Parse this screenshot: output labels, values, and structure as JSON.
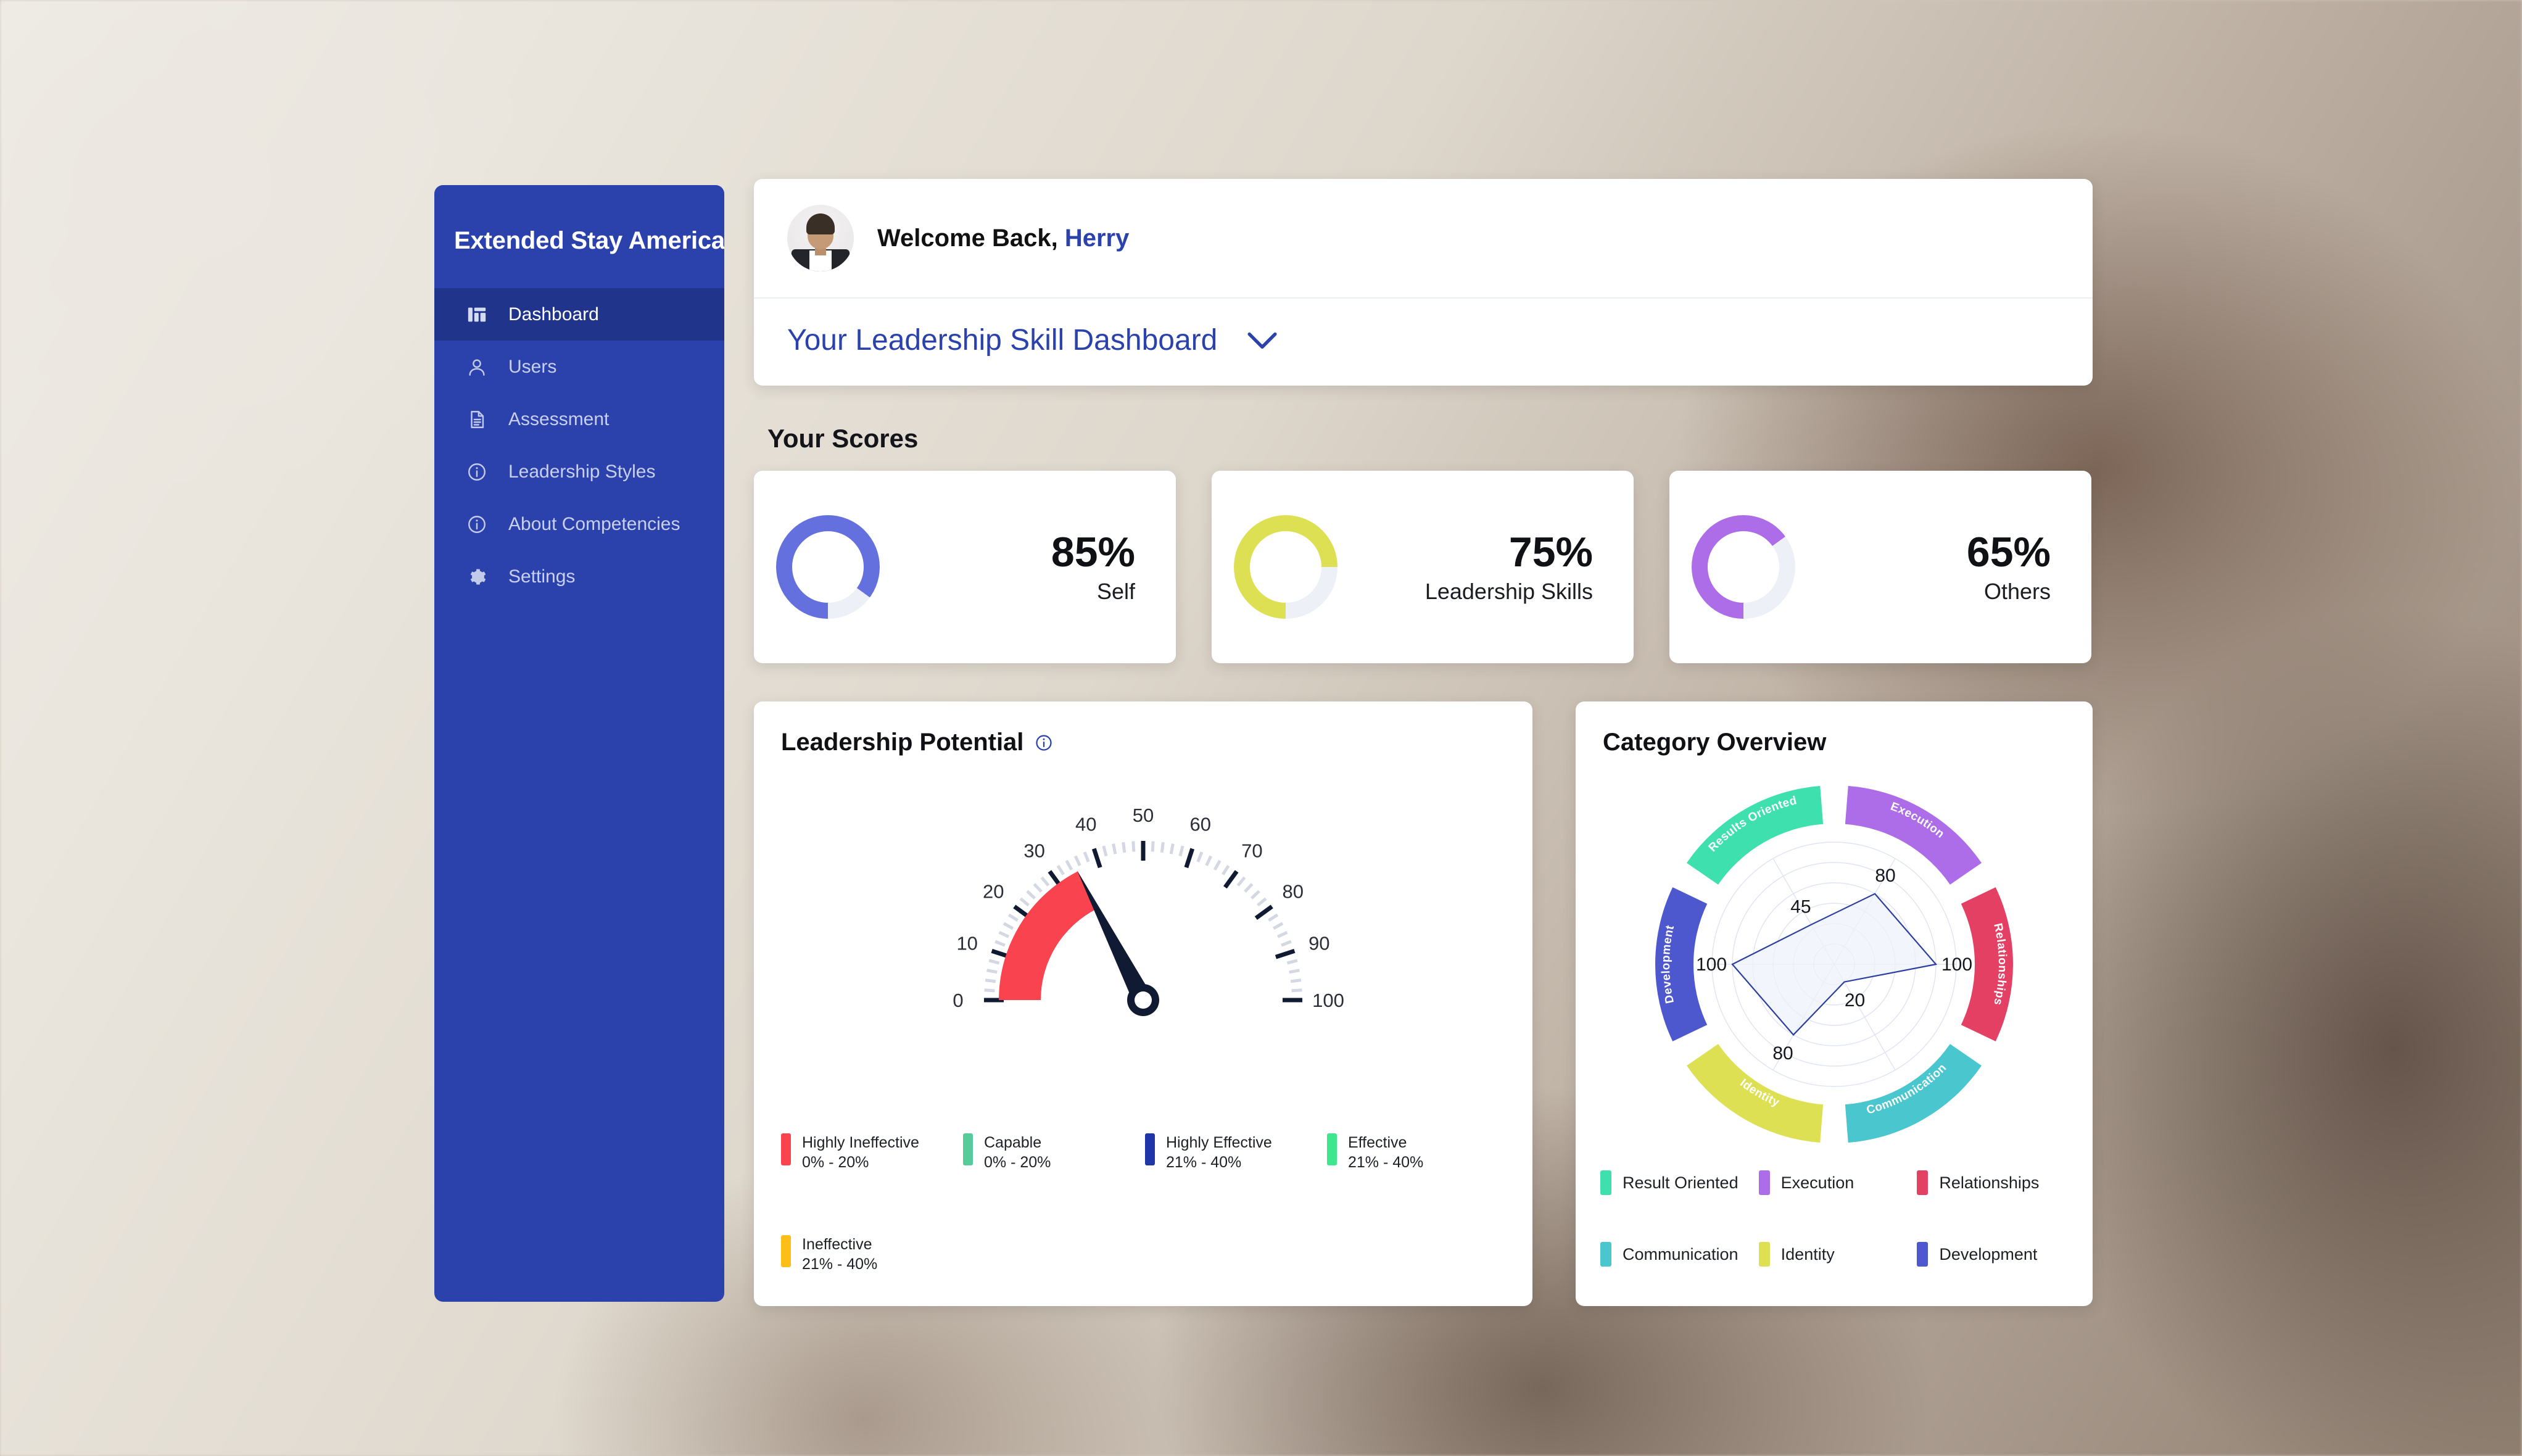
{
  "sidebar": {
    "brand": "Extended Stay America",
    "items": [
      {
        "label": "Dashboard",
        "icon": "dashboard-icon",
        "active": true
      },
      {
        "label": "Users",
        "icon": "user-icon",
        "active": false
      },
      {
        "label": "Assessment",
        "icon": "document-icon",
        "active": false
      },
      {
        "label": "Leadership Styles",
        "icon": "info-circle-icon",
        "active": false
      },
      {
        "label": "About Competencies",
        "icon": "info-circle-icon",
        "active": false
      },
      {
        "label": "Settings",
        "icon": "gear-icon",
        "active": false
      }
    ],
    "bg_color": "#2B42AC",
    "active_color": "#20348C"
  },
  "header": {
    "welcome_prefix": "Welcome Back,",
    "user_name": "Herry",
    "dashboard_select": "Your Leadership Skill Dashboard",
    "chevron_icon": "chevron-down-icon",
    "accent_color": "#2B42AC"
  },
  "scores": {
    "heading": "Your Scores",
    "cards": [
      {
        "percent": "85%",
        "label": "Self",
        "value": 85,
        "color": "#6470DE",
        "track": "#EEF0F8"
      },
      {
        "percent": "75%",
        "label": "Leadership Skills",
        "value": 75,
        "color": "#DEE054",
        "track": "#EEF0F8"
      },
      {
        "percent": "65%",
        "label": "Others",
        "value": 65,
        "color": "#AE6DE8",
        "track": "#EEF0F8"
      }
    ]
  },
  "leadership_potential": {
    "title": "Leadership Potential",
    "info_icon": "info-circle-icon",
    "legend": [
      {
        "name": "Highly Ineffective",
        "range": "0% - 20%",
        "color": "#F9444F"
      },
      {
        "name": "Capable",
        "range": "0% - 20%",
        "color": "#56CC9D"
      },
      {
        "name": "Highly Effective",
        "range": "21% - 40%",
        "color": "#1F35A8"
      },
      {
        "name": "Effective",
        "range": "21% - 40%",
        "color": "#3EE68E"
      },
      {
        "name": "Ineffective",
        "range": "21% - 40%",
        "color": "#FBBF17"
      }
    ]
  },
  "category_overview": {
    "title": "Category Overview",
    "legend": [
      {
        "name": "Result Oriented",
        "color": "#3EE0AE"
      },
      {
        "name": "Execution",
        "color": "#AE6DE8"
      },
      {
        "name": "Relationships",
        "color": "#E44063"
      },
      {
        "name": "Communication",
        "color": "#49C6CE"
      },
      {
        "name": "Identity",
        "color": "#DEE054"
      },
      {
        "name": "Development",
        "color": "#4D58CE"
      }
    ]
  },
  "chart_data": [
    {
      "type": "gauge",
      "title": "Leadership Potential",
      "value": 35,
      "min": 0,
      "max": 100,
      "tick_labels": [
        "0",
        "10",
        "20",
        "30",
        "40",
        "50",
        "60",
        "70",
        "80",
        "90",
        "100"
      ],
      "major_tick_step": 10,
      "minor_tick_step": 2,
      "needle_color": "#101B33",
      "bands": [
        {
          "from": 0,
          "to": 35,
          "color": "#F9444F",
          "label": "Highly Ineffective"
        }
      ],
      "legend": [
        {
          "name": "Highly Ineffective",
          "range": "0% - 20%",
          "color": "#F9444F"
        },
        {
          "name": "Capable",
          "range": "0% - 20%",
          "color": "#56CC9D"
        },
        {
          "name": "Highly Effective",
          "range": "21% - 40%",
          "color": "#1F35A8"
        },
        {
          "name": "Effective",
          "range": "21% - 40%",
          "color": "#3EE68E"
        },
        {
          "name": "Ineffective",
          "range": "21% - 40%",
          "color": "#FBBF17"
        }
      ]
    },
    {
      "type": "radar",
      "title": "Category Overview",
      "categories": [
        "Execution",
        "Relationships",
        "Communication",
        "Identity",
        "Development",
        "Results Oriented"
      ],
      "values": [
        80,
        100,
        20,
        80,
        100,
        45
      ],
      "value_labels": [
        "80",
        "100",
        "20",
        "80",
        "100",
        "45"
      ],
      "rmin": 0,
      "rmax": 120,
      "rings": 5,
      "grid": true,
      "fill_color": "#EEF1FA",
      "line_color": "#2B3FA0",
      "segment_colors": [
        "#AE6DE8",
        "#E44063",
        "#49C6CE",
        "#DEE054",
        "#4D58CE",
        "#3EE0AE"
      ],
      "legend_position": "bottom",
      "legend": [
        {
          "name": "Result Oriented",
          "color": "#3EE0AE"
        },
        {
          "name": "Execution",
          "color": "#AE6DE8"
        },
        {
          "name": "Relationships",
          "color": "#E44063"
        },
        {
          "name": "Communication",
          "color": "#49C6CE"
        },
        {
          "name": "Identity",
          "color": "#DEE054"
        },
        {
          "name": "Development",
          "color": "#4D58CE"
        }
      ]
    }
  ]
}
